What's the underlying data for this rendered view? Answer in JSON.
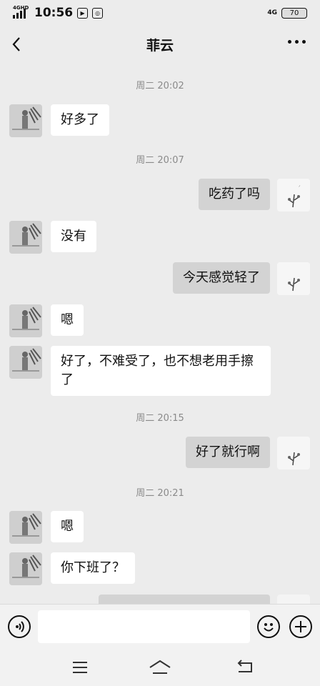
{
  "status_bar": {
    "network_tag": "4GHD",
    "time": "10:56",
    "network_type": "4G",
    "battery": "70"
  },
  "header": {
    "title": "菲云"
  },
  "messages": [
    {
      "kind": "timestamp",
      "text": "周二 20:02"
    },
    {
      "kind": "msg",
      "side": "left",
      "text": "好多了"
    },
    {
      "kind": "timestamp",
      "text": "周二 20:07"
    },
    {
      "kind": "msg",
      "side": "right",
      "text": "吃药了吗"
    },
    {
      "kind": "msg",
      "side": "left",
      "text": "没有"
    },
    {
      "kind": "msg",
      "side": "right",
      "text": "今天感觉轻了"
    },
    {
      "kind": "msg",
      "side": "left",
      "text": "嗯"
    },
    {
      "kind": "msg",
      "side": "left",
      "text": "好了，不难受了，也不想老用手擦"
    },
    {
      "kind": "msg",
      "side": "left",
      "text": "了"
    },
    {
      "kind": "timestamp",
      "text": "周二 20:15"
    },
    {
      "kind": "msg",
      "side": "right",
      "text": "好了就行啊"
    },
    {
      "kind": "timestamp",
      "text": "周二 20:21"
    },
    {
      "kind": "msg",
      "side": "left",
      "text": "嗯"
    },
    {
      "kind": "msg",
      "side": "left",
      "text": "你下班了？"
    }
  ],
  "input": {
    "value": "",
    "placeholder": ""
  },
  "icons": {
    "back": "chevron-left-icon",
    "more": "more-dots-icon",
    "voice": "voice-icon",
    "emoji": "emoji-icon",
    "plus": "plus-icon",
    "nav_menu": "menu-icon",
    "nav_home": "home-icon",
    "nav_back": "return-icon"
  }
}
